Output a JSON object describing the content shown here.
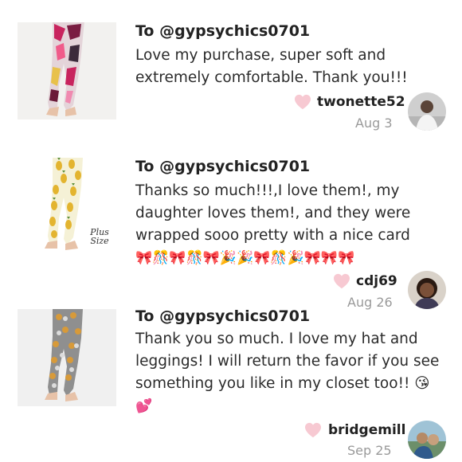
{
  "reviews": [
    {
      "to": "To @gypsychics0701",
      "message_lines": [
        "Love my purchase, super soft and",
        "extremely comfortable. Thank you!!!"
      ],
      "username": "twonette52",
      "date": "Aug 3",
      "plus_size_label": ""
    },
    {
      "to": "To @gypsychics0701",
      "message_lines": [
        "Thanks so much!!!,I love them!, my",
        "daughter loves them!, and they were",
        "wrapped sooo pretty with a nice card"
      ],
      "emoji_line": "🎀🎊🎀🎊🎀🎉🎉🎀🎊🎉🎀🎀🎀",
      "username": "cdj69",
      "date": "Aug 26",
      "plus_size_label": "Plus Size"
    },
    {
      "to": "To @gypsychics0701",
      "message_lines": [
        "Thank you so much. I love my hat and",
        "leggings! I will return the favor if you see",
        "something you like in my closet too!! 😘"
      ],
      "emoji_line": "💕",
      "username": "bridgemill",
      "date": "Sep 25",
      "plus_size_label": ""
    }
  ],
  "colors": {
    "heart": "#f7c9d2",
    "date": "#9a9a9a",
    "text": "#222222"
  },
  "icons": {
    "heart": "heart-icon",
    "avatar": "avatar"
  }
}
